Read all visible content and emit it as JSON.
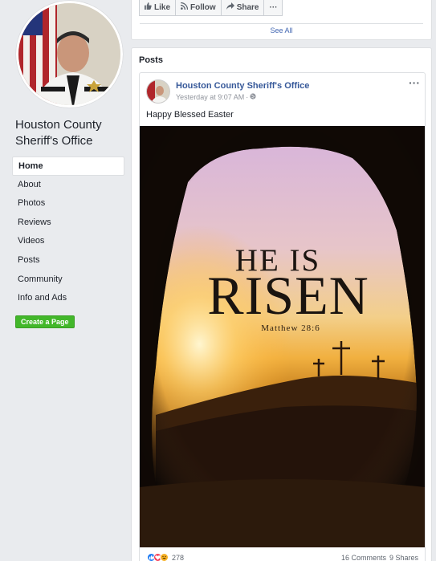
{
  "page": {
    "name": "Houston County Sheriff's Office"
  },
  "sidebar": {
    "items": [
      {
        "label": "Home",
        "active": true
      },
      {
        "label": "About"
      },
      {
        "label": "Photos"
      },
      {
        "label": "Reviews"
      },
      {
        "label": "Videos"
      },
      {
        "label": "Posts"
      },
      {
        "label": "Community"
      },
      {
        "label": "Info and Ads"
      }
    ],
    "create_page_label": "Create a Page"
  },
  "actions": {
    "like_label": "Like",
    "follow_label": "Follow",
    "share_label": "Share",
    "more_label": "···"
  },
  "see_all_label": "See All",
  "posts_section": {
    "heading": "Posts"
  },
  "post": {
    "author": "Houston County Sheriff's Office",
    "time": "Yesterday at 9:07 AM",
    "separator": "·",
    "text": "Happy Blessed Easter",
    "menu_label": "···",
    "image_text": {
      "line1": "HE IS",
      "line2": "RISEN",
      "reference": "Matthew 28:6"
    },
    "reaction_count": "278",
    "comments_label": "16 Comments",
    "shares_label": "9 Shares"
  },
  "icons": {
    "like": "thumbs-up-icon",
    "follow": "rss-icon",
    "share": "share-arrow-icon",
    "privacy": "globe-icon"
  },
  "colors": {
    "background": "#e9ebee",
    "link": "#365899",
    "create_button": "#42b72a",
    "like_reaction": "#1877f2",
    "love_reaction": "#f33e58",
    "haha_reaction": "#f7b125"
  }
}
